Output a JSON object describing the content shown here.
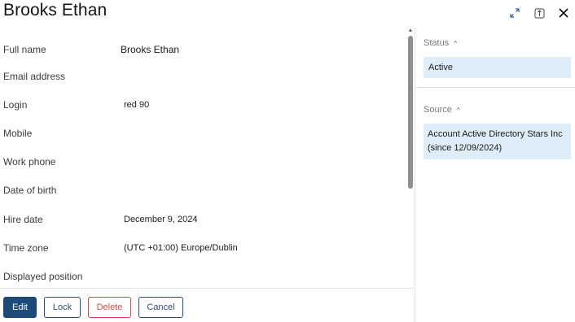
{
  "header": {
    "title": "Brooks Ethan",
    "icons": [
      "expand-icon",
      "pin-icon",
      "close-icon"
    ]
  },
  "fields": [
    {
      "label": "Full name",
      "value": "Brooks Ethan"
    },
    {
      "label": "Email address",
      "value": ""
    },
    {
      "label": "Login",
      "value": "red 90"
    },
    {
      "label": "Mobile",
      "value": ""
    },
    {
      "label": "Work phone",
      "value": ""
    },
    {
      "label": "Date of birth",
      "value": ""
    },
    {
      "label": "Hire date",
      "value": "December 9, 2024"
    },
    {
      "label": "Time zone",
      "value": "(UTC +01:00) Europe/Dublin"
    },
    {
      "label": "Displayed position",
      "value": ""
    }
  ],
  "footer": {
    "edit_label": "Edit",
    "lock_label": "Lock",
    "delete_label": "Delete",
    "cancel_label": "Cancel"
  },
  "sidebar": {
    "status": {
      "heading": "Status",
      "value": "Active"
    },
    "source": {
      "heading": "Source",
      "value_line1": "Account Active Directory Stars Inc",
      "value_line2": "(since 12/09/2024)"
    }
  },
  "colors": {
    "primary": "#1d4a78",
    "danger": "#d94848",
    "chip_bg": "#deedf7"
  }
}
